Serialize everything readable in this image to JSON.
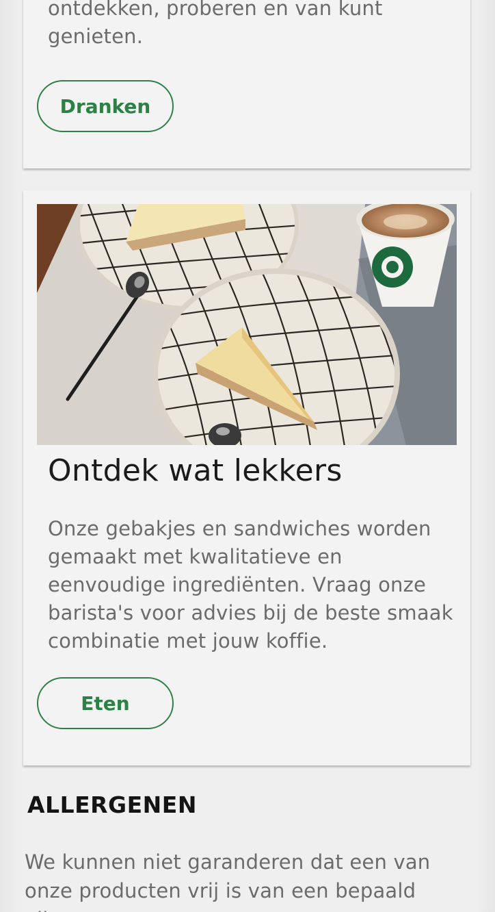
{
  "drinks_card": {
    "text": "ontdekken, proberen en van kunt genieten.",
    "button_label": "Dranken"
  },
  "food_card": {
    "image_icon": "cheesecake-photo",
    "title": "Ontdek wat lekkers",
    "text": "Onze gebakjes en sandwiches worden gemaakt met kwalitatieve en eenvoudige ingrediënten. Vraag onze barista's voor advies bij de beste smaak combinatie met jouw koffie.",
    "button_label": "Eten"
  },
  "allergens": {
    "heading": "ALLERGENEN",
    "text": "We kunnen niet garanderen dat een van onze producten vrij is van een bepaald allergeen"
  },
  "colors": {
    "accent": "#2e8047",
    "card_bg": "#f3f3f3",
    "body_text": "#6b6b6b",
    "heading_text": "#1b1b1b"
  }
}
